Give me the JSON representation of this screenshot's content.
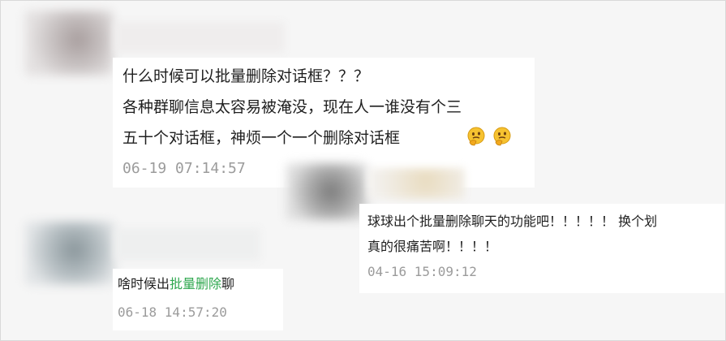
{
  "comment1": {
    "line1": "什么时候可以批量删除对话框？？？",
    "line2": "各种群聊信息太容易被淹没，现在人一谁没有个三",
    "line3": "五十个对话框，神烦一个一个删除对话框",
    "emoji": "thinking-face",
    "timestamp": "06-19 07:14:57"
  },
  "comment2": {
    "line1": "球球出个批量删除聊天的功能吧！！！！！ 换个划",
    "line2": "真的很痛苦啊！！！！",
    "timestamp": "04-16 15:09:12"
  },
  "comment3": {
    "prefix": "啥时候出",
    "highlight": "批量删除",
    "suffix": "聊",
    "timestamp": "06-18 14:57:20"
  },
  "colors": {
    "highlight": "#2fa84f",
    "timestamp": "#9b9b9b",
    "text": "#1f1f1f"
  }
}
